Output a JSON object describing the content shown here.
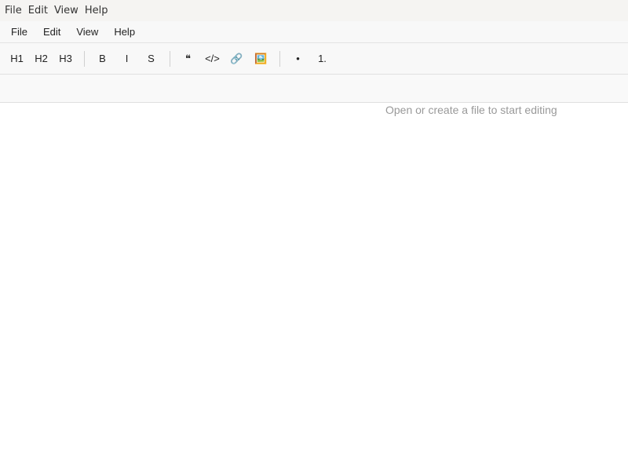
{
  "native_menu": {
    "items": [
      {
        "label": "File"
      },
      {
        "label": "Edit"
      },
      {
        "label": "View"
      },
      {
        "label": "Help"
      }
    ]
  },
  "app_menu": {
    "items": [
      {
        "label": "File"
      },
      {
        "label": "Edit"
      },
      {
        "label": "View"
      },
      {
        "label": "Help"
      }
    ]
  },
  "toolbar": {
    "h1": "H1",
    "h2": "H2",
    "h3": "H3",
    "bold": "B",
    "italic": "I",
    "strike": "S",
    "quote": "❝",
    "code": "</>",
    "link": "🔗",
    "image": "🖼️",
    "bullet_list": "•",
    "numbered_list": "1."
  },
  "editor": {
    "placeholder": "Open or create a file to start editing"
  }
}
